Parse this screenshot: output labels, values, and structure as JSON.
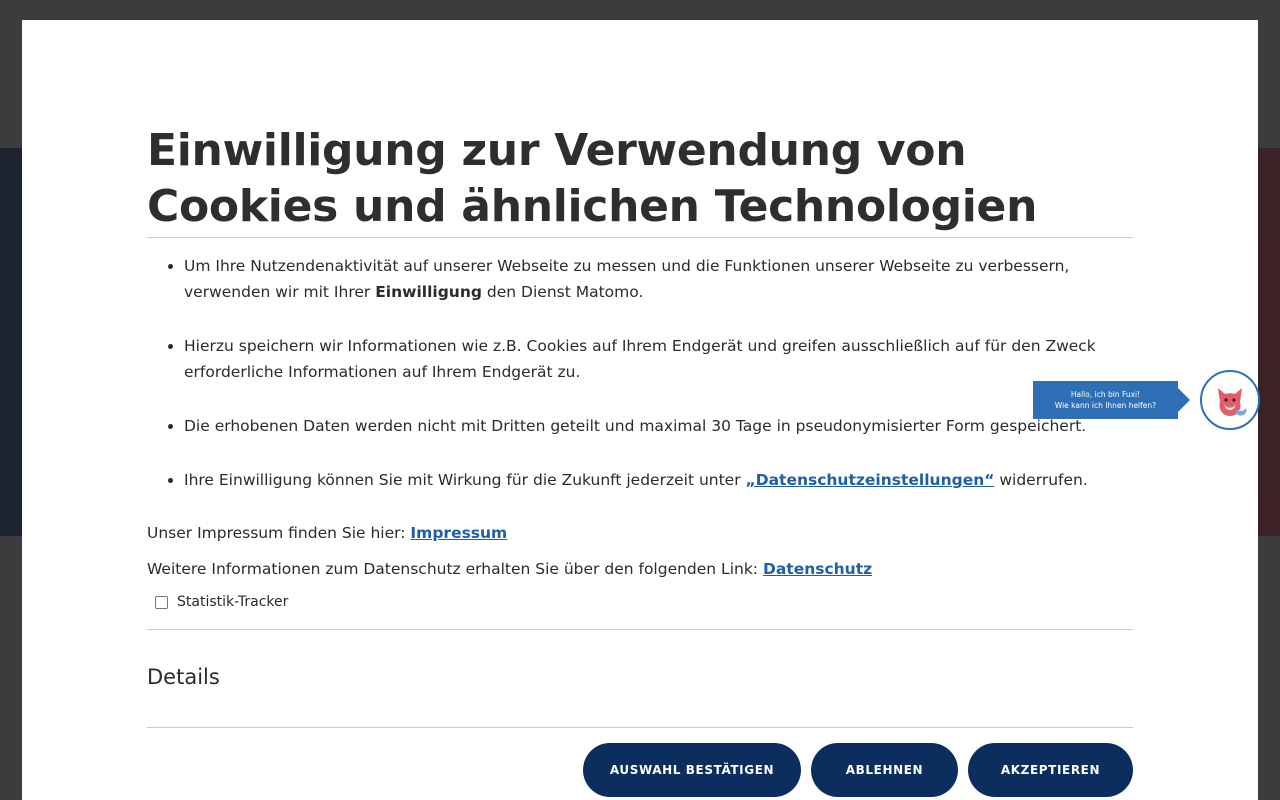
{
  "dialog": {
    "title": "Einwilligung zur Verwendung von Cookies und ähnlichen Technologien",
    "points": [
      {
        "pre": "Um Ihre Nutzendenaktivität auf unserer Webseite zu messen und die Funktionen unserer Webseite zu verbessern, verwenden wir mit Ihrer ",
        "bold": "Einwilligung",
        "post": " den Dienst Matomo."
      },
      {
        "text": "Hierzu speichern wir Informationen wie z.B. Cookies auf Ihrem Endgerät und greifen ausschließlich auf für den Zweck erforderliche Informationen auf Ihrem Endgerät zu."
      },
      {
        "text": "Die erhobenen Daten werden nicht mit Dritten geteilt und maximal 30 Tage in pseudonymisierter Form gespeichert."
      },
      {
        "pre": "Ihre Einwilligung können Sie mit Wirkung für die Zukunft jederzeit unter ",
        "link": "„Datenschutzeinstellungen“",
        "post": " widerrufen."
      }
    ],
    "impressum_text": "Unser Impressum finden Sie hier: ",
    "impressum_link": "Impressum",
    "privacy_text": "Weitere Informationen zum Datenschutz erhalten Sie über den folgenden Link: ",
    "privacy_link": "Datenschutz",
    "checkbox_label": "Statistik-Tracker",
    "checkbox_checked": false,
    "details_heading": "Details",
    "buttons": {
      "confirm": "AUSWAHL BESTÄTIGEN",
      "reject": "ABLEHNEN",
      "accept": "AKZEPTIEREN"
    }
  },
  "chatbot": {
    "line1": "Hallo, ich bin Fuxi!",
    "line2": "Wie kann ich Ihnen helfen?"
  },
  "colors": {
    "button_bg": "#0c2e5e",
    "link": "#1f5fa8",
    "chat_accent": "#2f6fb6"
  }
}
